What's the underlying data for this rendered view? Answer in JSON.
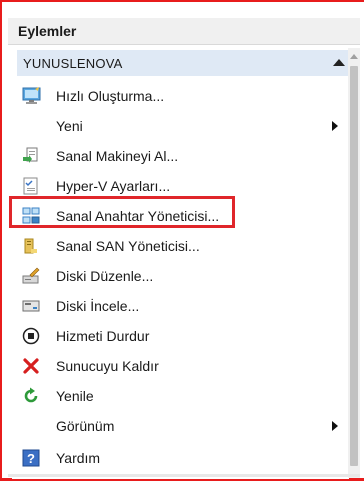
{
  "pane": {
    "title": "Eylemler"
  },
  "section": {
    "title": "YUNUSLENOVA"
  },
  "items": [
    {
      "label": "Hızlı Oluşturma...",
      "icon": "quick-create-icon"
    },
    {
      "label": "Yeni",
      "icon": "none",
      "submenu": true
    },
    {
      "label": "Sanal Makineyi Al...",
      "icon": "import-vm-icon"
    },
    {
      "label": "Hyper-V Ayarları...",
      "icon": "hyperv-settings-icon"
    },
    {
      "label": "Sanal Anahtar Yöneticisi...",
      "icon": "virtual-switch-manager-icon"
    },
    {
      "label": "Sanal SAN Yöneticisi...",
      "icon": "virtual-san-manager-icon"
    },
    {
      "label": "Diski Düzenle...",
      "icon": "edit-disk-icon"
    },
    {
      "label": "Diski İncele...",
      "icon": "inspect-disk-icon"
    },
    {
      "label": "Hizmeti Durdur",
      "icon": "stop-service-icon"
    },
    {
      "label": "Sunucuyu Kaldır",
      "icon": "remove-server-icon"
    },
    {
      "label": "Yenile",
      "icon": "refresh-icon"
    },
    {
      "label": "Görünüm",
      "icon": "none",
      "submenu": true
    },
    {
      "label": "Yardım",
      "icon": "help-icon"
    }
  ],
  "colors": {
    "highlight": "#e0262a",
    "frame": "#e81c1c",
    "section_bg": "#dfe9f5"
  }
}
